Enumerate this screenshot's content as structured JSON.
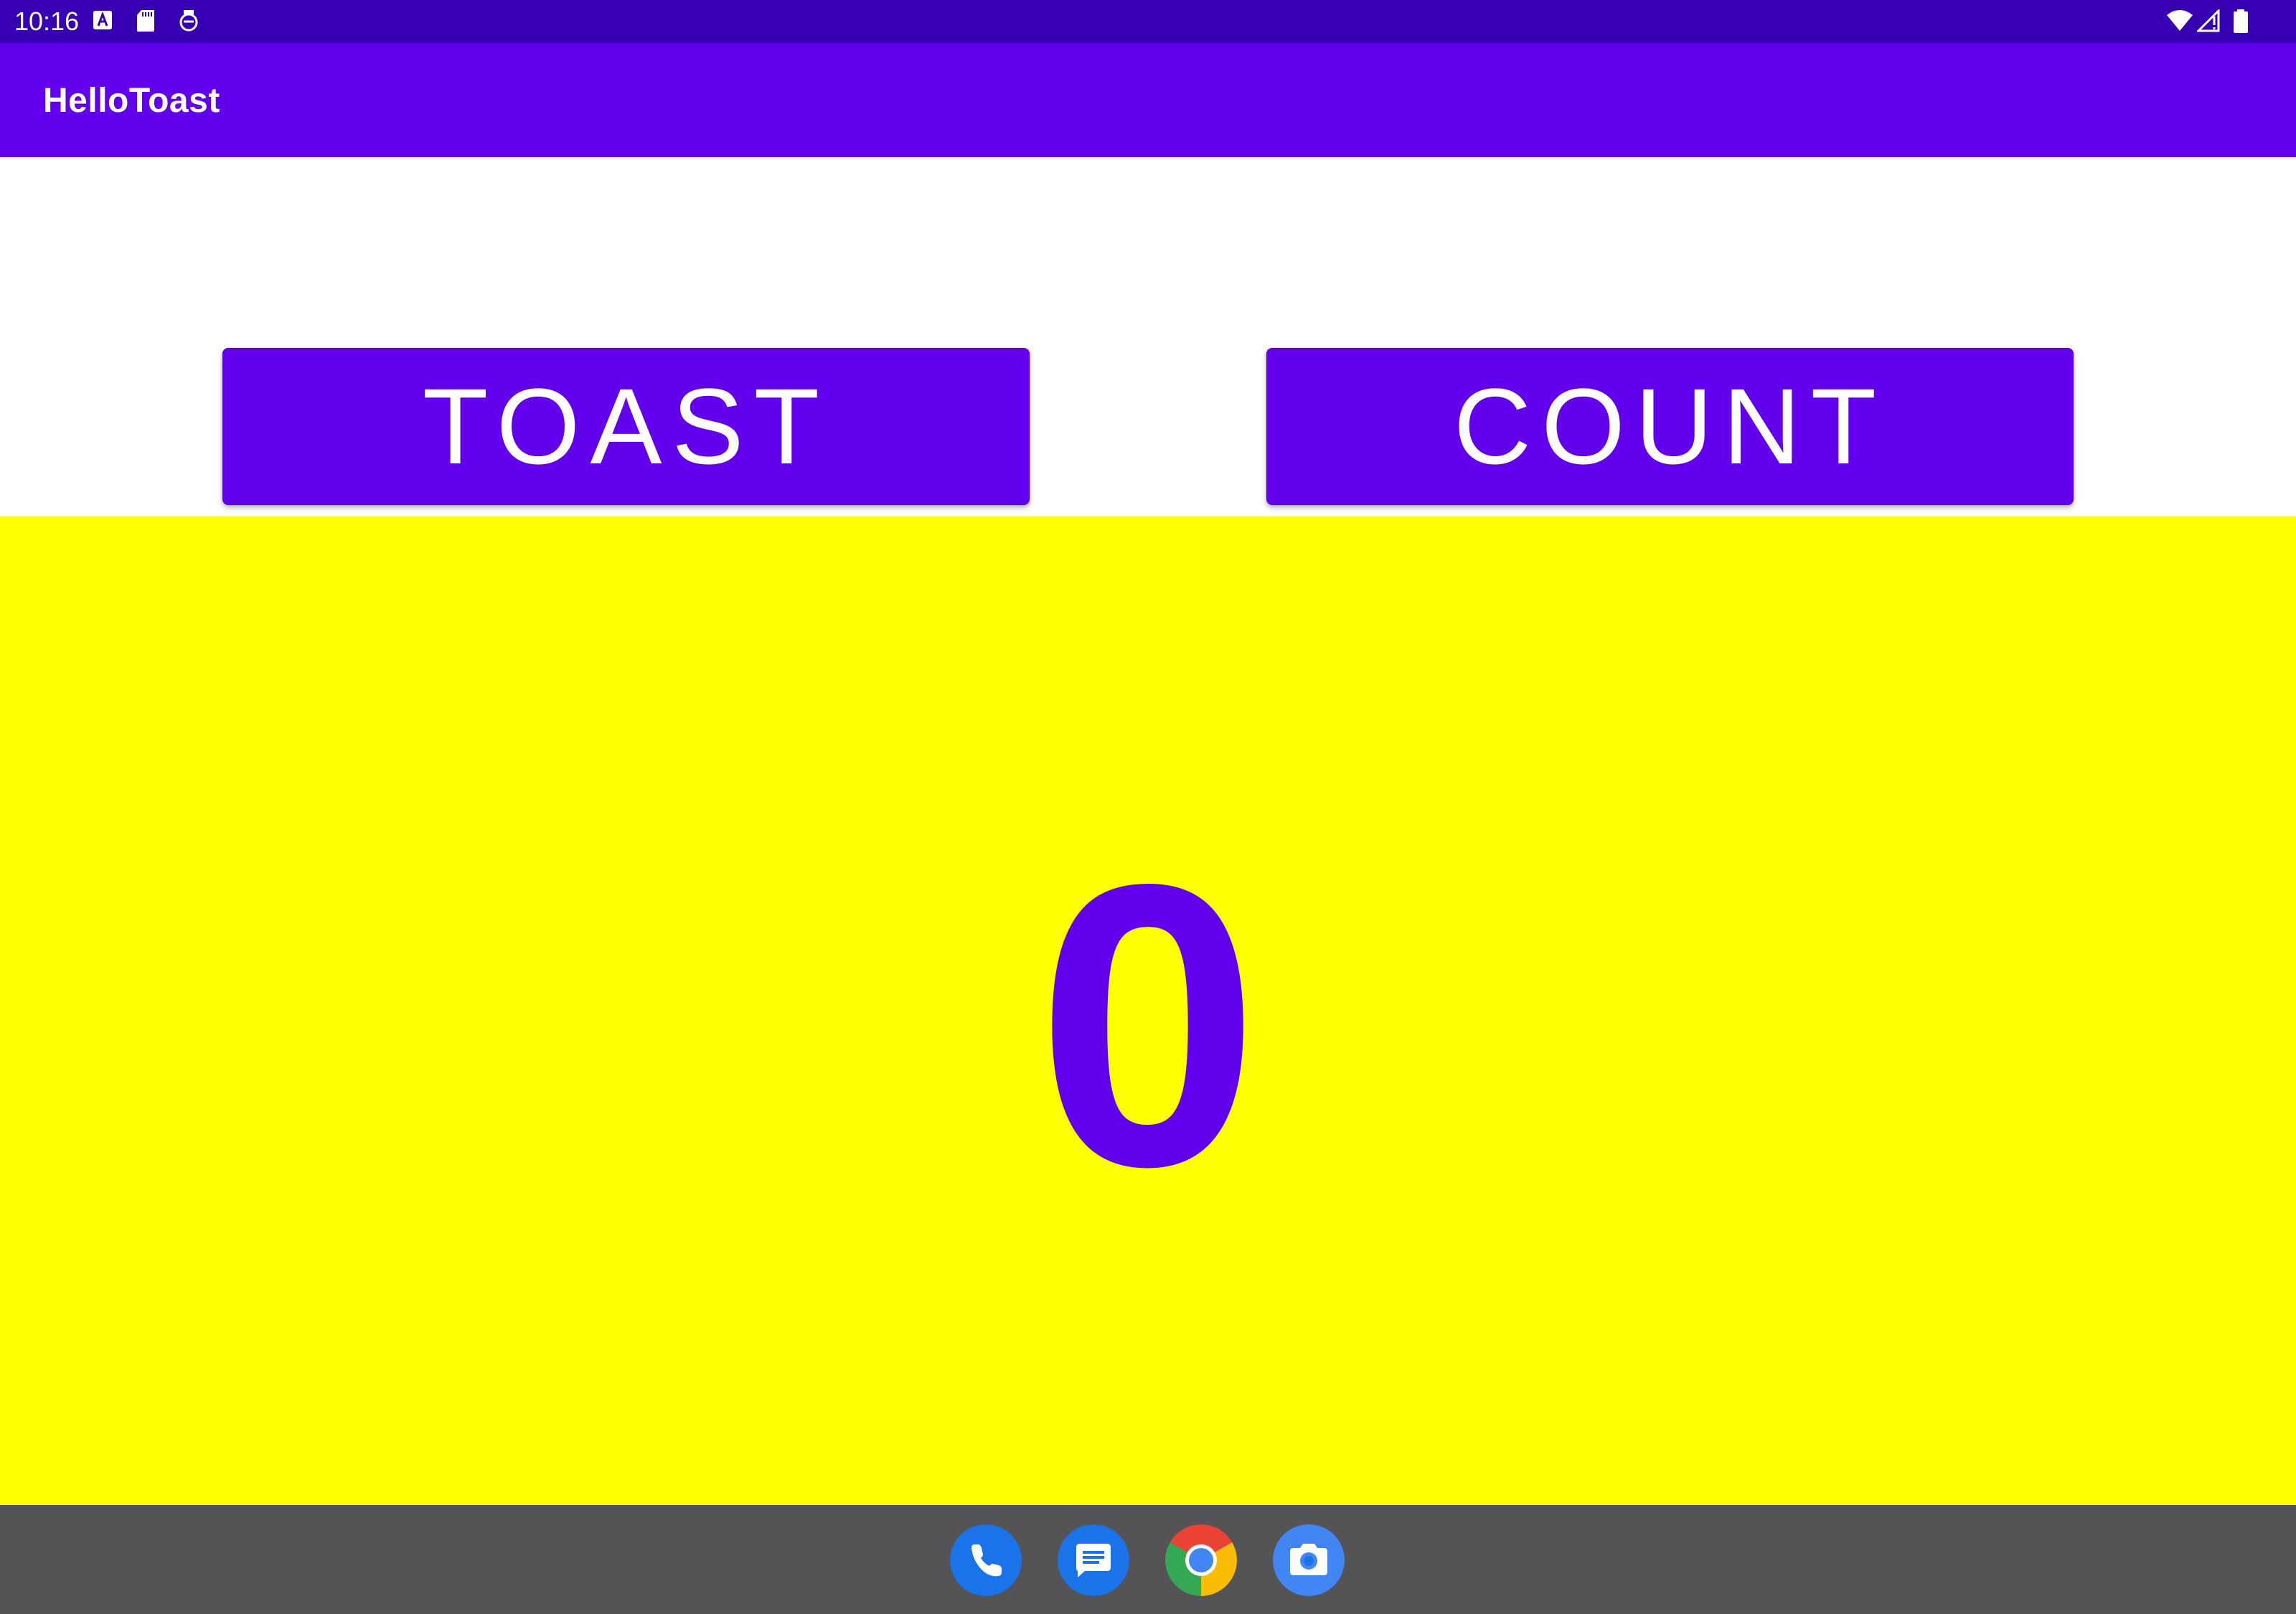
{
  "status_bar": {
    "time": "10:16",
    "left_icons": [
      "a-box-icon",
      "sd-card-icon",
      "sync-icon"
    ],
    "right_icons": [
      "wifi-icon",
      "signal-icon",
      "battery-icon"
    ]
  },
  "app_bar": {
    "title": "HelloToast"
  },
  "buttons": {
    "toast_label": "TOAST",
    "count_label": "COUNT"
  },
  "counter": {
    "value": "0"
  },
  "dock": {
    "apps": [
      "phone-icon",
      "messages-icon",
      "chrome-icon",
      "camera-icon"
    ]
  },
  "colors": {
    "status_bar": "#3700b3",
    "primary": "#6200ee",
    "count_background": "#ffff00",
    "nav_bar": "#545457"
  }
}
